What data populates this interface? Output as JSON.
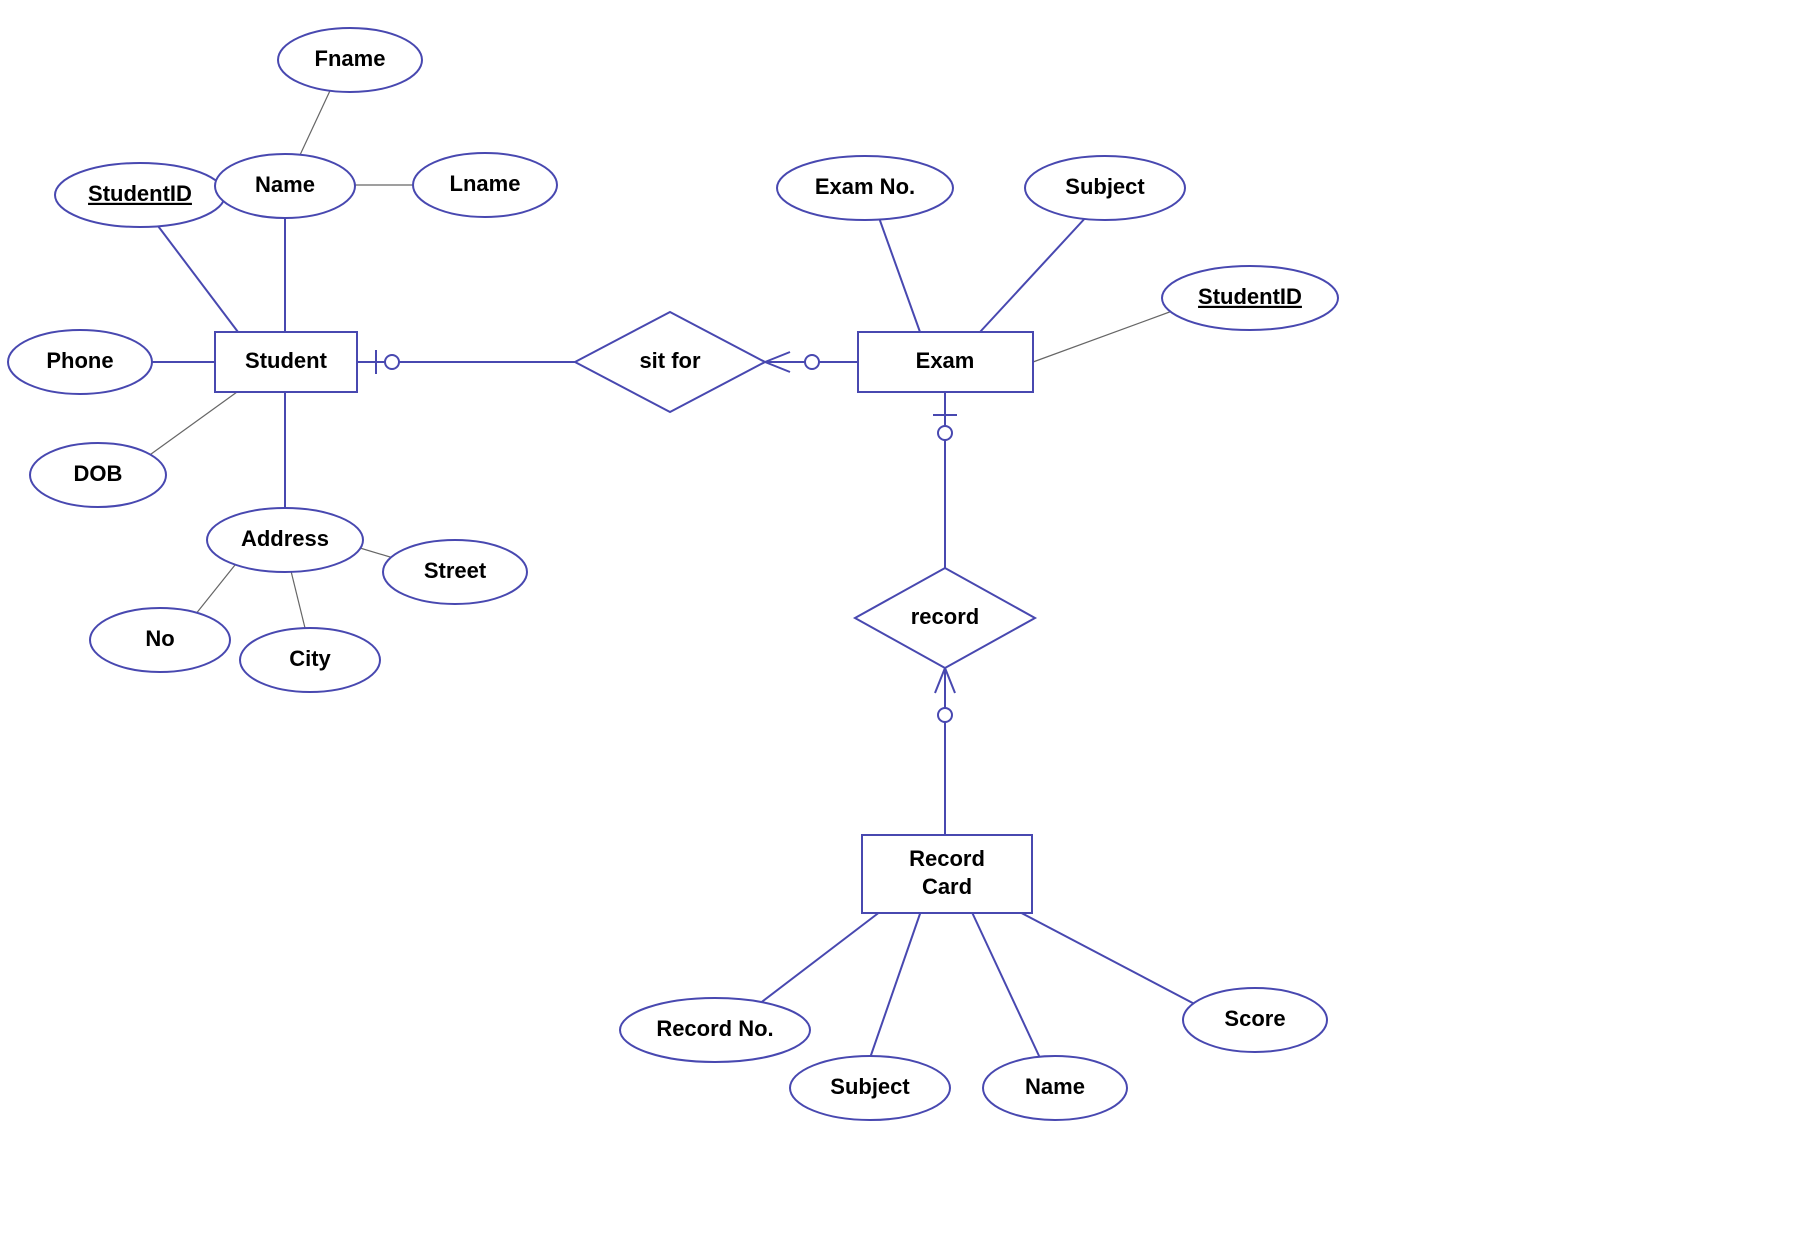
{
  "entities": {
    "student": "Student",
    "exam": "Exam",
    "recordcard_l1": "Record",
    "recordcard_l2": "Card"
  },
  "relationships": {
    "sitfor": "sit for",
    "record": "record"
  },
  "attributes": {
    "student_id": "StudentID",
    "name": "Name",
    "fname": "Fname",
    "lname": "Lname",
    "phone": "Phone",
    "dob": "DOB",
    "address": "Address",
    "no": "No",
    "city": "City",
    "street": "Street",
    "exam_no": "Exam No.",
    "exam_subject": "Subject",
    "exam_student_id": "StudentID",
    "record_no": "Record No.",
    "rc_subject": "Subject",
    "rc_name": "Name",
    "score": "Score"
  }
}
